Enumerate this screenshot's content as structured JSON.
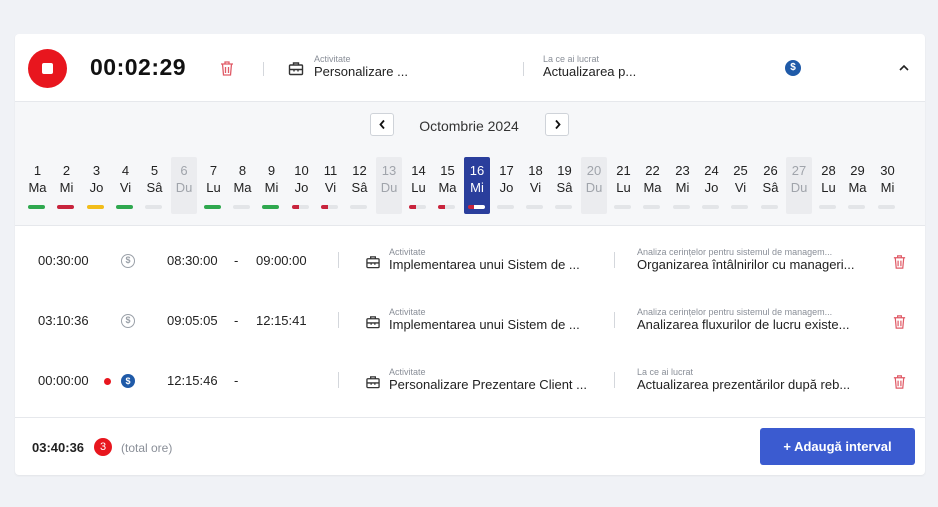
{
  "header": {
    "timer": "00:02:29",
    "activity_label": "Activitate",
    "activity_value": "Personalizare ...",
    "work_label": "La ce ai lucrat",
    "work_value": "Actualizarea p...",
    "billable_symbol": "$"
  },
  "calendar": {
    "month": "Octombrie 2024",
    "days": [
      {
        "num": "1",
        "wd": "Ma",
        "status": "green"
      },
      {
        "num": "2",
        "wd": "Mi",
        "status": "red"
      },
      {
        "num": "3",
        "wd": "Jo",
        "status": "yellow"
      },
      {
        "num": "4",
        "wd": "Vi",
        "status": "green"
      },
      {
        "num": "5",
        "wd": "Sâ",
        "status": "empty"
      },
      {
        "num": "6",
        "wd": "Du",
        "status": "sunday"
      },
      {
        "num": "7",
        "wd": "Lu",
        "status": "green"
      },
      {
        "num": "8",
        "wd": "Ma",
        "status": "empty"
      },
      {
        "num": "9",
        "wd": "Mi",
        "status": "green"
      },
      {
        "num": "10",
        "wd": "Jo",
        "status": "partial"
      },
      {
        "num": "11",
        "wd": "Vi",
        "status": "partial"
      },
      {
        "num": "12",
        "wd": "Sâ",
        "status": "empty"
      },
      {
        "num": "13",
        "wd": "Du",
        "status": "sunday"
      },
      {
        "num": "14",
        "wd": "Lu",
        "status": "partial"
      },
      {
        "num": "15",
        "wd": "Ma",
        "status": "partial"
      },
      {
        "num": "16",
        "wd": "Mi",
        "status": "selected"
      },
      {
        "num": "17",
        "wd": "Jo",
        "status": "empty"
      },
      {
        "num": "18",
        "wd": "Vi",
        "status": "empty"
      },
      {
        "num": "19",
        "wd": "Sâ",
        "status": "empty"
      },
      {
        "num": "20",
        "wd": "Du",
        "status": "sunday"
      },
      {
        "num": "21",
        "wd": "Lu",
        "status": "empty"
      },
      {
        "num": "22",
        "wd": "Ma",
        "status": "empty"
      },
      {
        "num": "23",
        "wd": "Mi",
        "status": "empty"
      },
      {
        "num": "24",
        "wd": "Jo",
        "status": "empty"
      },
      {
        "num": "25",
        "wd": "Vi",
        "status": "empty"
      },
      {
        "num": "26",
        "wd": "Sâ",
        "status": "empty"
      },
      {
        "num": "27",
        "wd": "Du",
        "status": "sunday"
      },
      {
        "num": "28",
        "wd": "Lu",
        "status": "empty"
      },
      {
        "num": "29",
        "wd": "Ma",
        "status": "empty"
      },
      {
        "num": "30",
        "wd": "Mi",
        "status": "empty"
      }
    ]
  },
  "entries": [
    {
      "duration": "00:30:00",
      "start": "08:30:00",
      "dash": "-",
      "end": "09:00:00",
      "activity_label": "Activitate",
      "activity_value": "Implementarea unui Sistem de ...",
      "work_label": "Analiza cerințelor pentru sistemul de managem...",
      "work_value": "Organizarea întâlnirilor cu manageri...",
      "billable_symbol": "$"
    },
    {
      "duration": "03:10:36",
      "start": "09:05:05",
      "dash": "-",
      "end": "12:15:41",
      "activity_label": "Activitate",
      "activity_value": "Implementarea unui Sistem de ...",
      "work_label": "Analiza cerințelor pentru sistemul de managem...",
      "work_value": "Analizarea fluxurilor de lucru existe...",
      "billable_symbol": "$"
    },
    {
      "duration": "00:00:00",
      "start": "12:15:46",
      "dash": "-",
      "end": "",
      "activity_label": "Activitate",
      "activity_value": "Personalizare Prezentare Client ...",
      "work_label": "La ce ai lucrat",
      "work_value": "Actualizarea prezentărilor după reb...",
      "billable_symbol": "$"
    }
  ],
  "footer": {
    "total": "03:40:36",
    "count": "3",
    "total_note": "(total ore)",
    "add_button": "+ Adaugă interval"
  },
  "colors": {
    "stop": "#e8161e",
    "selected_day": "#2a3e9c",
    "green": "#2fa84f",
    "red": "#c8243d",
    "yellow": "#f2bd1a",
    "primary_button": "#3b5bd0",
    "billable_blue": "#1f5aa8"
  }
}
